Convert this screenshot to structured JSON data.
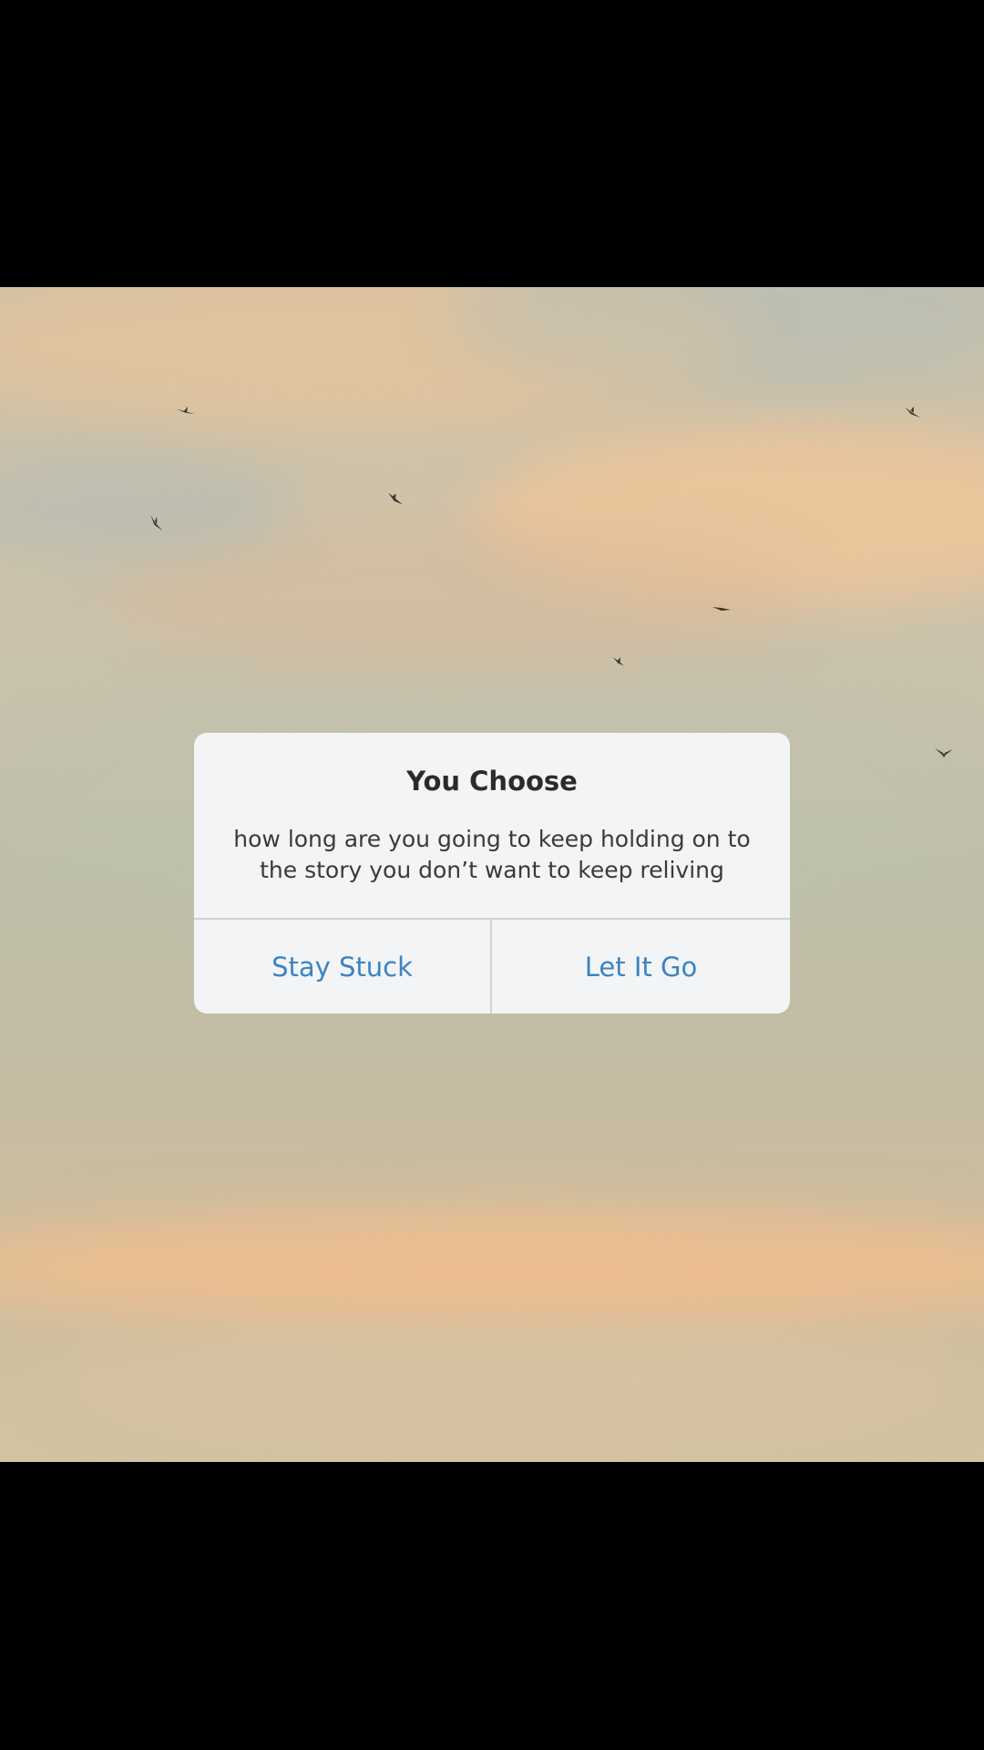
{
  "dialog": {
    "title": "You Choose",
    "message": "how long are you going to keep holding on to the story you don’t want to keep reliving",
    "buttons": {
      "left_label": "Stay Stuck",
      "right_label": "Let It Go"
    }
  },
  "colors": {
    "button_text": "#3a84c4",
    "dialog_bg": "#f3f4f5",
    "letterbox": "#000000"
  }
}
